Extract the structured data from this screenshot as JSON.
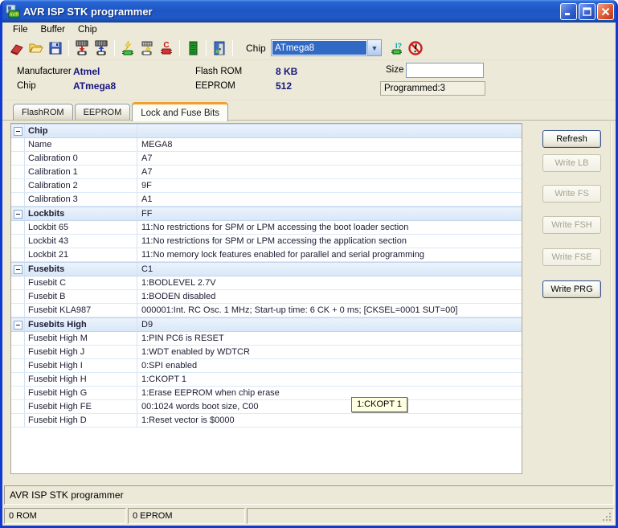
{
  "window": {
    "title": "AVR ISP STK programmer"
  },
  "menu": {
    "items": [
      "File",
      "Buffer",
      "Chip"
    ]
  },
  "toolbar": {
    "chip_label": "Chip",
    "chip_selected": "ATmega8",
    "icons": [
      "erase-buffer-icon",
      "open-file-icon",
      "save-file-icon",
      "write-flash-icon",
      "read-flash-icon",
      "program-chip-icon",
      "verify-chip-icon",
      "erase-chip-icon",
      "chip-socket-icon",
      "exit-icon",
      "chip-info-icon",
      "cancel-icon"
    ]
  },
  "info": {
    "manufacturer_label": "Manufacturer",
    "manufacturer": "Atmel",
    "chip_label": "Chip",
    "chip": "ATmega8",
    "flash_label": "Flash ROM",
    "flash": "8 KB",
    "eeprom_label": "EEPROM",
    "eeprom": "512",
    "size_label": "Size",
    "size_value": "",
    "programmed": "Programmed:3"
  },
  "tabs": [
    {
      "label": "FlashROM",
      "active": false
    },
    {
      "label": "EEPROM",
      "active": false
    },
    {
      "label": "Lock and Fuse Bits",
      "active": true
    }
  ],
  "fuse_table": {
    "rows": [
      {
        "type": "group",
        "name": "Chip",
        "value": ""
      },
      {
        "type": "item",
        "name": "Name",
        "value": "MEGA8"
      },
      {
        "type": "item",
        "name": "Calibration 0",
        "value": "A7"
      },
      {
        "type": "item",
        "name": "Calibration 1",
        "value": "A7"
      },
      {
        "type": "item",
        "name": "Calibration 2",
        "value": "9F"
      },
      {
        "type": "item",
        "name": "Calibration 3",
        "value": "A1"
      },
      {
        "type": "group",
        "name": "Lockbits",
        "value": "FF"
      },
      {
        "type": "item",
        "name": "Lockbit 65",
        "value": "11:No restrictions for SPM or LPM accessing the boot loader section"
      },
      {
        "type": "item",
        "name": "Lockbit 43",
        "value": "11:No restrictions for SPM or LPM accessing the application section"
      },
      {
        "type": "item",
        "name": "Lockbit 21",
        "value": "11:No memory lock features enabled for parallel and serial programming"
      },
      {
        "type": "group",
        "name": "Fusebits",
        "value": "C1"
      },
      {
        "type": "item",
        "name": "Fusebit C",
        "value": "1:BODLEVEL 2.7V"
      },
      {
        "type": "item",
        "name": "Fusebit B",
        "value": "1:BODEN disabled"
      },
      {
        "type": "item",
        "name": "Fusebit KLA987",
        "value": "000001:Int. RC Osc. 1 MHz; Start-up time: 6 CK + 0 ms; [CKSEL=0001 SUT=00]"
      },
      {
        "type": "group",
        "name": "Fusebits High",
        "value": "D9"
      },
      {
        "type": "item",
        "name": "Fusebit High M",
        "value": "1:PIN PC6 is RESET"
      },
      {
        "type": "item",
        "name": "Fusebit High J",
        "value": "1:WDT enabled by WDTCR"
      },
      {
        "type": "item",
        "name": "Fusebit High I",
        "value": "0:SPI enabled"
      },
      {
        "type": "item",
        "name": "Fusebit High H",
        "value": "1:CKOPT 1"
      },
      {
        "type": "item",
        "name": "Fusebit High G",
        "value": "1:Erase EEPROM when chip erase"
      },
      {
        "type": "item",
        "name": "Fusebit High FE",
        "value": "00:1024 words boot size, C00"
      },
      {
        "type": "item",
        "name": "Fusebit High D",
        "value": "1:Reset vector is $0000"
      }
    ]
  },
  "buttons": [
    {
      "label": "Refresh",
      "enabled": true
    },
    {
      "label": "Write LB",
      "enabled": false
    },
    {
      "label": "Write FS",
      "enabled": false
    },
    {
      "label": "Write FSH",
      "enabled": false
    },
    {
      "label": "Write FSE",
      "enabled": false
    },
    {
      "label": "Write PRG",
      "enabled": true
    }
  ],
  "tooltip": {
    "text": "1:CKOPT 1"
  },
  "statusbar": {
    "message": "AVR ISP STK programmer",
    "panels": [
      "0 ROM",
      "0 EPROM",
      ""
    ]
  },
  "colors": {
    "titlebar_blue": "#1e56c4",
    "frame_blue": "#0f3bd0",
    "selection_blue": "#316ac5",
    "value_navy": "#16167e",
    "tooltip_bg": "#ffffe1",
    "active_tab_accent": "#f0a030",
    "group_row_bg": "#d9e7f8"
  }
}
